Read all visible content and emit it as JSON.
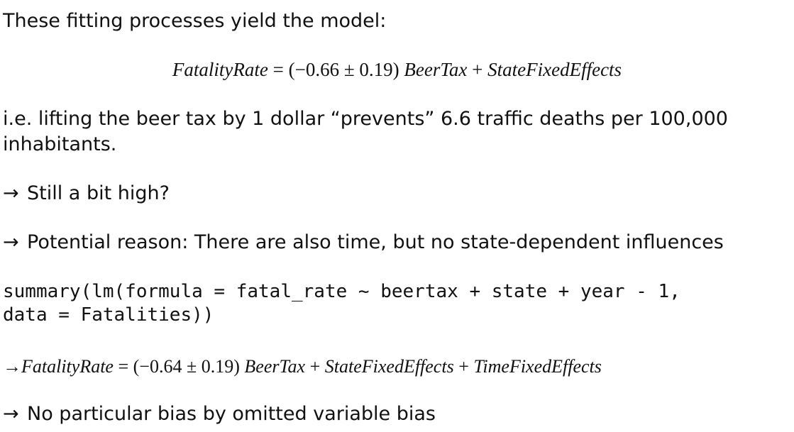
{
  "intro": "These fitting processes yield the model:",
  "model1": {
    "lhs": "FatalityRate",
    "eq": " = ",
    "coef": "(−0.66 ± 0.19) ",
    "term1": "BeerTax",
    "plus": " + ",
    "term2": "StateFixedEffects"
  },
  "interp_line1": "i.e. lifting the beer tax by 1 dollar “prevents” 6.6 traffic deaths per 100,000",
  "interp_line2": "inhabitants.",
  "arrow": "→",
  "bullet1": "Still a bit high?",
  "bullet2": "Potential reason: There are also time, but no state-dependent influences",
  "code_line1": "summary(lm(formula = fatal_rate ~ beertax + state + year - 1,",
  "code_line2": "data = Fatalities))",
  "model2": {
    "lhs": "FatalityRate",
    "eq": " = ",
    "coef": "(−0.64 ± 0.19) ",
    "term1": "BeerTax",
    "plus1": " + ",
    "term2": "StateFixedEffects",
    "plus2": " + ",
    "term3": "TimeFixedEffects"
  },
  "bullet3": "No particular bias by omitted variable bias"
}
